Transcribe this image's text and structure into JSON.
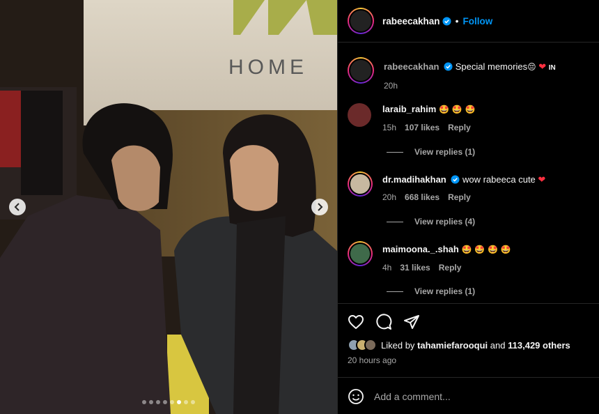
{
  "post": {
    "author": "rabeecakhan",
    "follow_label": "Follow",
    "separator": "•",
    "caption_text": "Special memories",
    "caption_tag": "IN",
    "caption_time": "20h"
  },
  "media": {
    "sign_text": "HOME",
    "dot_count": 8,
    "active_dot": 6
  },
  "comments": [
    {
      "user": "laraib_rahim",
      "verified": false,
      "text": "🤩 🤩 🤩",
      "time": "15h",
      "likes": "107 likes",
      "reply": "Reply",
      "view_replies": "View replies (1)",
      "avatar_color": "#6b2a2a"
    },
    {
      "user": "dr.madihakhan",
      "verified": true,
      "text": "wow rabeeca cute",
      "time": "20h",
      "likes": "668 likes",
      "reply": "Reply",
      "view_replies": "View replies (4)",
      "avatar_color": "#c7b8a0"
    },
    {
      "user": "maimoona._.shah",
      "verified": false,
      "text": "🤩 🤩 🤩 🤩",
      "time": "4h",
      "likes": "31 likes",
      "reply": "Reply",
      "view_replies": "View replies (1)",
      "avatar_color": "#3f6a4a"
    }
  ],
  "engagement": {
    "liked_by_prefix": "Liked by",
    "liked_by_user": "tahamiefarooqui",
    "liked_by_and": "and",
    "others": "113,429 others",
    "ago": "20 hours ago"
  },
  "add_comment": {
    "placeholder": "Add a comment..."
  },
  "colors": {
    "accent": "#0095f6",
    "heart": "#ff3040",
    "muted": "#a8a8a8"
  }
}
